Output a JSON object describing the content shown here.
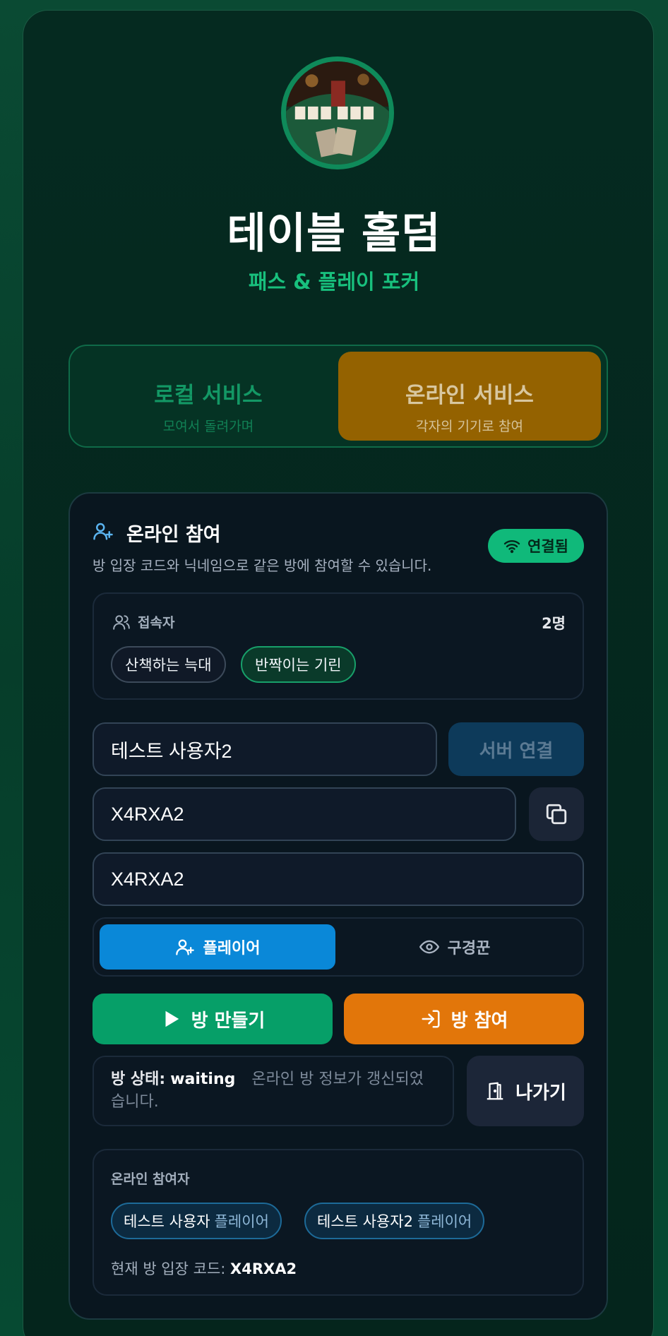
{
  "app": {
    "title": "테이블 홀덤",
    "subtitle": "패스 & 플레이 포커"
  },
  "modes": [
    {
      "title": "로컬 서비스",
      "sub": "모여서 돌려가며",
      "active": false
    },
    {
      "title": "온라인 서비스",
      "sub": "각자의 기기로 참여",
      "active": true
    }
  ],
  "online": {
    "title": "온라인 참여",
    "description": "방 입장 코드와 닉네임으로 같은 방에 참여할 수 있습니다.",
    "connection_status": "연결됨",
    "users_label": "접속자",
    "users_count": "2명",
    "users": [
      "산책하는 늑대",
      "반짝이는 기린"
    ],
    "nickname_value": "테스트 사용자2",
    "connect_button": "서버 연결",
    "room_code_value": "X4RXA2",
    "join_code_value": "X4RXA2",
    "roles": {
      "player": "플레이어",
      "spectator": "구경꾼",
      "selected": "player"
    },
    "create_button": "방 만들기",
    "join_button": "방 참여",
    "status_label": "방 상태:",
    "status_value": "waiting",
    "status_message": "온라인 방 정보가 갱신되었습니다.",
    "leave_button": "나가기",
    "participants_label": "온라인 참여자",
    "participants": [
      {
        "name": "테스트 사용자",
        "role": "플레이어"
      },
      {
        "name": "테스트 사용자2",
        "role": "플레이어"
      }
    ],
    "current_code_label": "현재 방 입장 코드:",
    "current_code_value": "X4RXA2"
  },
  "colors": {
    "accent_green": "#18c07d",
    "online_active": "#946200",
    "player_blue": "#0a88d8",
    "create_green": "#069f68",
    "join_orange": "#e2760a"
  }
}
